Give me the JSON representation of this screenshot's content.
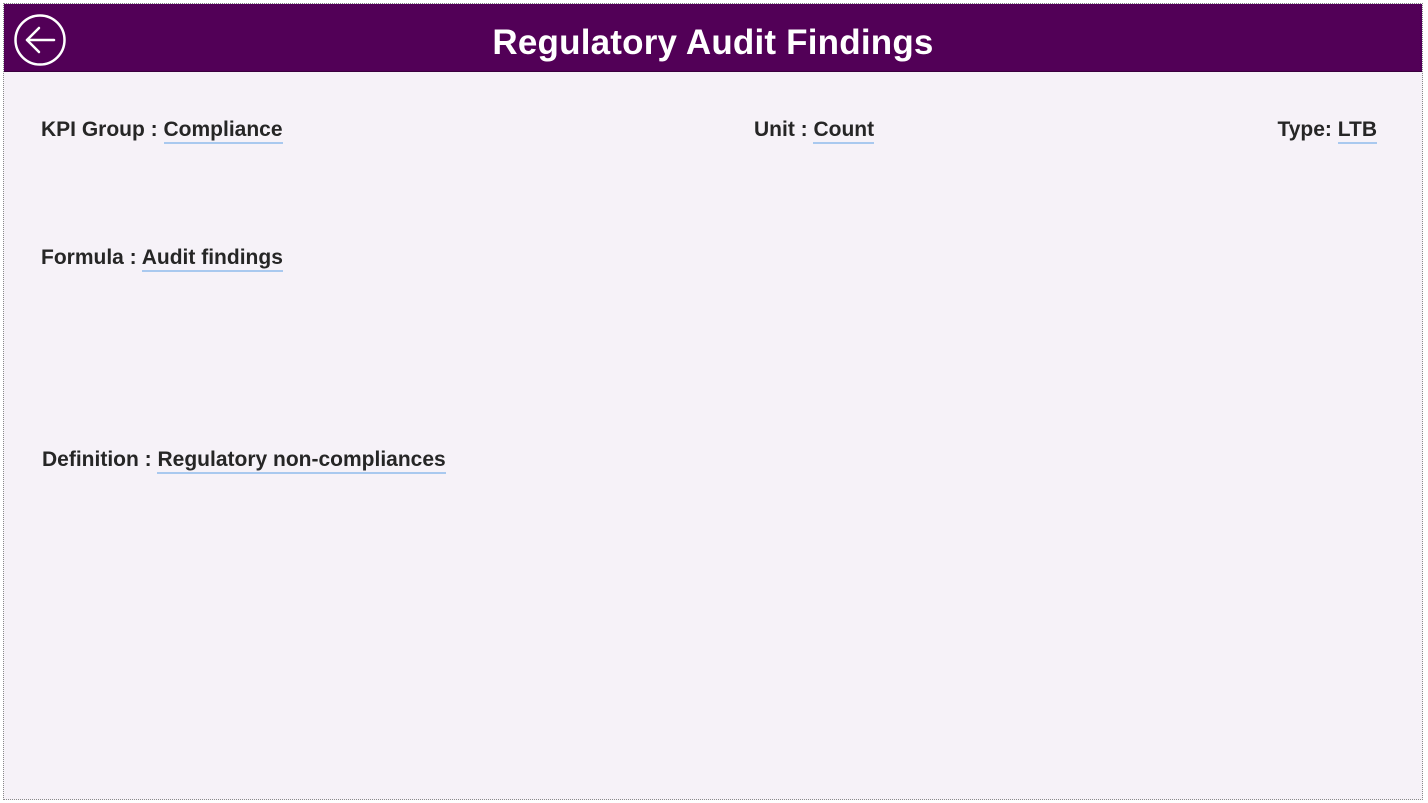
{
  "header": {
    "title": "Regulatory Audit Findings",
    "back_icon": "arrow-left-circle-icon",
    "background_color": "#520057"
  },
  "fields": {
    "kpi_group": {
      "label": "KPI Group : ",
      "value": "Compliance"
    },
    "unit": {
      "label": "Unit : ",
      "value": "Count"
    },
    "type": {
      "label": "Type: ",
      "value": "LTB"
    },
    "formula": {
      "label": "Formula : ",
      "value": "Audit findings"
    },
    "definition": {
      "label": "Definition : ",
      "value": "Regulatory non-compliances"
    }
  }
}
